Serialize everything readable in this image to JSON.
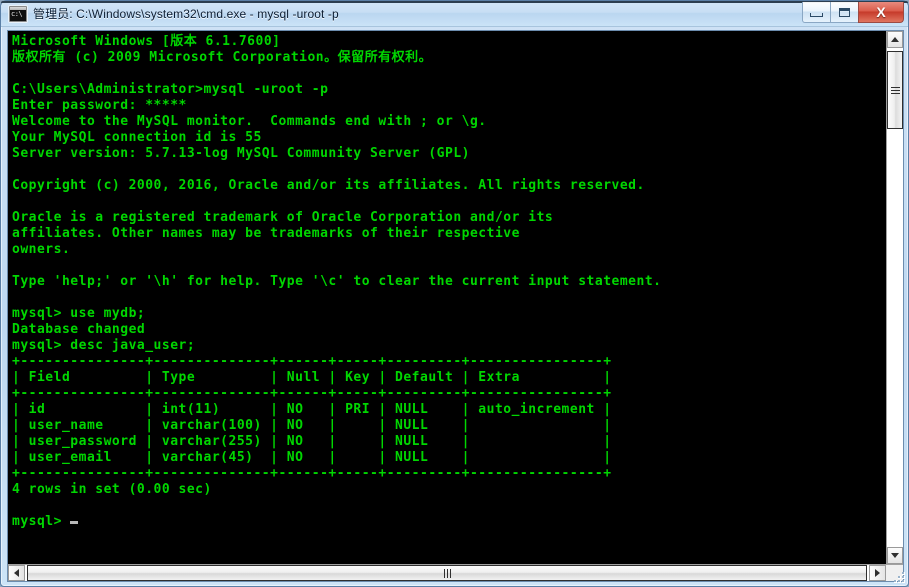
{
  "window": {
    "title": "管理员: C:\\Windows\\system32\\cmd.exe - mysql  -uroot -p",
    "icon": "cmd-console-icon",
    "buttons": {
      "minimize_label": "–",
      "maximize_label": "□",
      "close_label": "X"
    },
    "colors": {
      "console_background": "#000000",
      "console_text": "#00d700",
      "titlebar": "#c7def4",
      "close_button": "#c63a2a",
      "frame_border": "#5b7fa6"
    }
  },
  "console": {
    "prompt_cursor": "block-underscore",
    "lines": [
      "Microsoft Windows [版本 6.1.7600]",
      "版权所有 (c) 2009 Microsoft Corporation。保留所有权利。",
      "",
      "C:\\Users\\Administrator>mysql -uroot -p",
      "Enter password: *****",
      "Welcome to the MySQL monitor.  Commands end with ; or \\g.",
      "Your MySQL connection id is 55",
      "Server version: 5.7.13-log MySQL Community Server (GPL)",
      "",
      "Copyright (c) 2000, 2016, Oracle and/or its affiliates. All rights reserved.",
      "",
      "Oracle is a registered trademark of Oracle Corporation and/or its",
      "affiliates. Other names may be trademarks of their respective",
      "owners.",
      "",
      "Type 'help;' or '\\h' for help. Type '\\c' to clear the current input statement.",
      "",
      "mysql> use mydb;",
      "Database changed",
      "mysql> desc java_user;",
      "+---------------+--------------+------+-----+---------+----------------+",
      "| Field         | Type         | Null | Key | Default | Extra          |",
      "+---------------+--------------+------+-----+---------+----------------+",
      "| id            | int(11)      | NO   | PRI | NULL    | auto_increment |",
      "| user_name     | varchar(100) | NO   |     | NULL    |                |",
      "| user_password | varchar(255) | NO   |     | NULL    |                |",
      "| user_email    | varchar(45)  | NO   |     | NULL    |                |",
      "+---------------+--------------+------+-----+---------+----------------+",
      "4 rows in set (0.00 sec)",
      "",
      "mysql> "
    ],
    "commands": [
      "mysql -uroot -p",
      "use mydb;",
      "desc java_user;"
    ],
    "mysql_session": {
      "connection_id": "55",
      "server_version": "5.7.13-log MySQL Community Server (GPL)",
      "database": "mydb",
      "table": "java_user",
      "result_status": "4 rows in set (0.00 sec)",
      "columns": [
        "Field",
        "Type",
        "Null",
        "Key",
        "Default",
        "Extra"
      ],
      "rows": [
        [
          "id",
          "int(11)",
          "NO",
          "PRI",
          "NULL",
          "auto_increment"
        ],
        [
          "user_name",
          "varchar(100)",
          "NO",
          "",
          "NULL",
          ""
        ],
        [
          "user_password",
          "varchar(255)",
          "NO",
          "",
          "NULL",
          ""
        ],
        [
          "user_email",
          "varchar(45)",
          "NO",
          "",
          "NULL",
          ""
        ]
      ]
    },
    "os_banner": {
      "product": "Microsoft Windows [版本 6.1.7600]",
      "copyright": "版权所有 (c) 2009 Microsoft Corporation。保留所有权利。"
    }
  },
  "scrollbars": {
    "vertical": {
      "up_arrow": "arrow-up-icon",
      "down_arrow": "arrow-down-icon",
      "thumb_position_percent": 0
    },
    "horizontal": {
      "left_arrow": "arrow-left-icon",
      "right_arrow": "arrow-right-icon",
      "thumb_position_percent": 0
    }
  }
}
